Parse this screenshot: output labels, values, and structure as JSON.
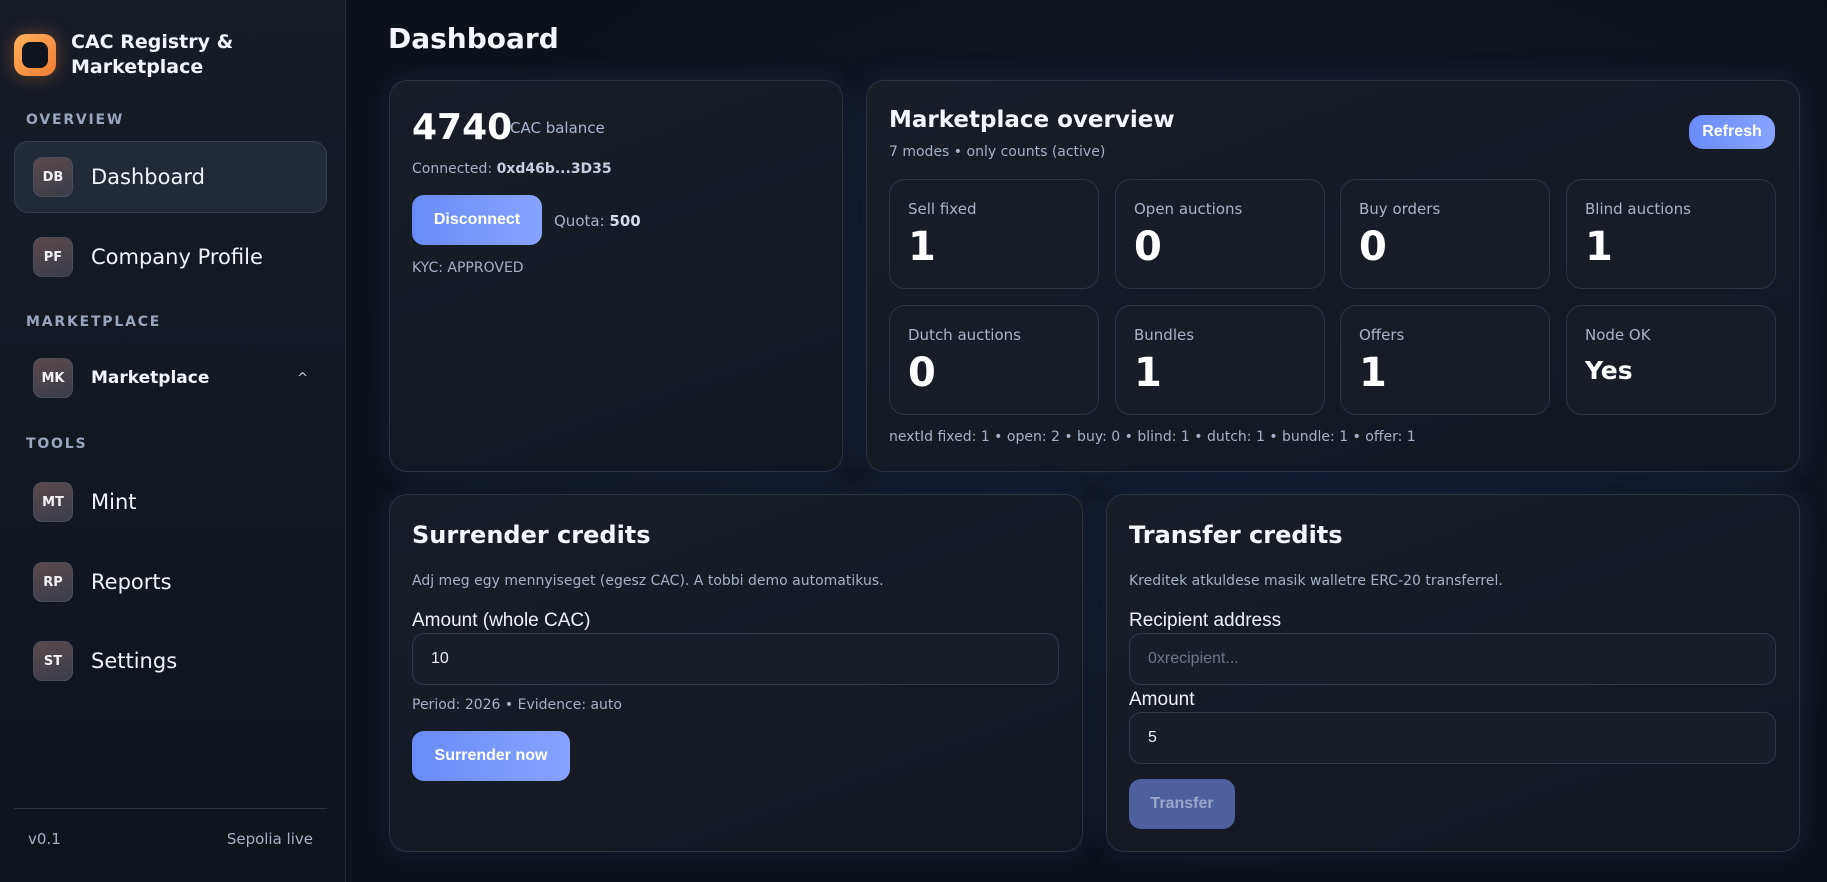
{
  "brand": {
    "title": "CAC Registry & Marketplace"
  },
  "sidebar": {
    "sections": {
      "overview": "OVERVIEW",
      "marketplace": "MARKETPLACE",
      "tools": "TOOLS"
    },
    "items": [
      {
        "badge": "DB",
        "label": "Dashboard"
      },
      {
        "badge": "PF",
        "label": "Company Profile"
      },
      {
        "badge": "MK",
        "label": "Marketplace",
        "caret": "^"
      },
      {
        "badge": "MT",
        "label": "Mint"
      },
      {
        "badge": "RP",
        "label": "Reports"
      },
      {
        "badge": "ST",
        "label": "Settings"
      }
    ],
    "footer": {
      "version": "v0.1",
      "network": "Sepolia live"
    }
  },
  "page": {
    "title": "Dashboard"
  },
  "balance": {
    "value": "4740",
    "unit": "CAC balance",
    "connected_label": "Connected:",
    "address": "0xd46b...3D35",
    "disconnect_label": "Disconnect",
    "quota_label": "Quota:",
    "quota_value": "500",
    "kyc": "KYC: APPROVED"
  },
  "market": {
    "title": "Marketplace overview",
    "subtitle": "7 modes • only counts (active)",
    "refresh_label": "Refresh",
    "stats": [
      {
        "label": "Sell fixed",
        "value": "1"
      },
      {
        "label": "Open auctions",
        "value": "0"
      },
      {
        "label": "Buy orders",
        "value": "0"
      },
      {
        "label": "Blind auctions",
        "value": "1"
      },
      {
        "label": "Dutch auctions",
        "value": "0"
      },
      {
        "label": "Bundles",
        "value": "1"
      },
      {
        "label": "Offers",
        "value": "1"
      },
      {
        "label": "Node OK",
        "value": "Yes"
      }
    ],
    "nextid": "nextId fixed: 1 • open: 2 • buy: 0 • blind: 1 • dutch: 1 • bundle: 1 • offer: 1"
  },
  "surrender": {
    "title": "Surrender credits",
    "description": "Adj meg egy mennyiseget (egesz CAC). A tobbi demo automatikus.",
    "amount_label": "Amount (whole CAC)",
    "amount_value": "10",
    "period": "Period: 2026 • Evidence: auto",
    "button_label": "Surrender now"
  },
  "transfer": {
    "title": "Transfer credits",
    "description": "Kreditek atkuldese masik walletre ERC-20 transferrel.",
    "recipient_label": "Recipient address",
    "recipient_placeholder": "0xrecipient...",
    "amount_label": "Amount",
    "amount_value": "5",
    "button_label": "Transfer"
  },
  "colors": {
    "accent": "#7b98fc",
    "background": "#0d1119",
    "card": "#171c26",
    "brand_orange": "#f59a45"
  }
}
